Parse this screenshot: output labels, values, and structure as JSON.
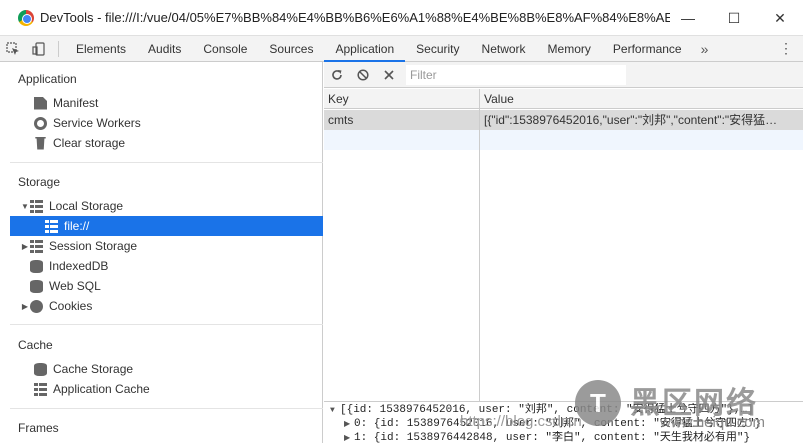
{
  "window": {
    "title": "DevTools - file:///I:/vue/04/05%E7%BB%84%E4%BB%B6%E6%A1%88%E4%BE%8B%E8%AF%84%E8%AE%BA...",
    "minimize": "—",
    "maximize": "☐",
    "close": "✕"
  },
  "tabs": [
    "Elements",
    "Audits",
    "Console",
    "Sources",
    "Application",
    "Security",
    "Network",
    "Memory",
    "Performance"
  ],
  "tabs_more": "»",
  "sidebar": {
    "application_head": "Application",
    "application_items": [
      "Manifest",
      "Service Workers",
      "Clear storage"
    ],
    "storage_head": "Storage",
    "local_storage": "Local Storage",
    "local_child": "file://",
    "session_storage": "Session Storage",
    "indexeddb": "IndexedDB",
    "websql": "Web SQL",
    "cookies": "Cookies",
    "cache_head": "Cache",
    "cache_storage": "Cache Storage",
    "app_cache": "Application Cache",
    "frames_head": "Frames"
  },
  "toolbar": {
    "filter_placeholder": "Filter"
  },
  "table": {
    "col_key": "Key",
    "col_value": "Value",
    "rows": [
      {
        "key": "cmts",
        "value": "[{\"id\":1538976452016,\"user\":\"刘邦\",\"content\":\"安得猛…"
      }
    ]
  },
  "preview": {
    "line0": "[{id: 1538976452016, user: \"刘邦\", content: \"安得猛士兮守四方\"},…]",
    "line1": "0: {id: 1538976452016, user: \"刘邦\", content: \"安得猛士兮守四方\"}",
    "line2": "1: {id: 1538976442848, user: \"李白\", content: \"天生我材必有用\"}"
  },
  "watermark": {
    "logo_glyph": "T",
    "title": "黑区网络",
    "url": "https://blog.csdn.n",
    "url2": "www.heiqu.com"
  }
}
